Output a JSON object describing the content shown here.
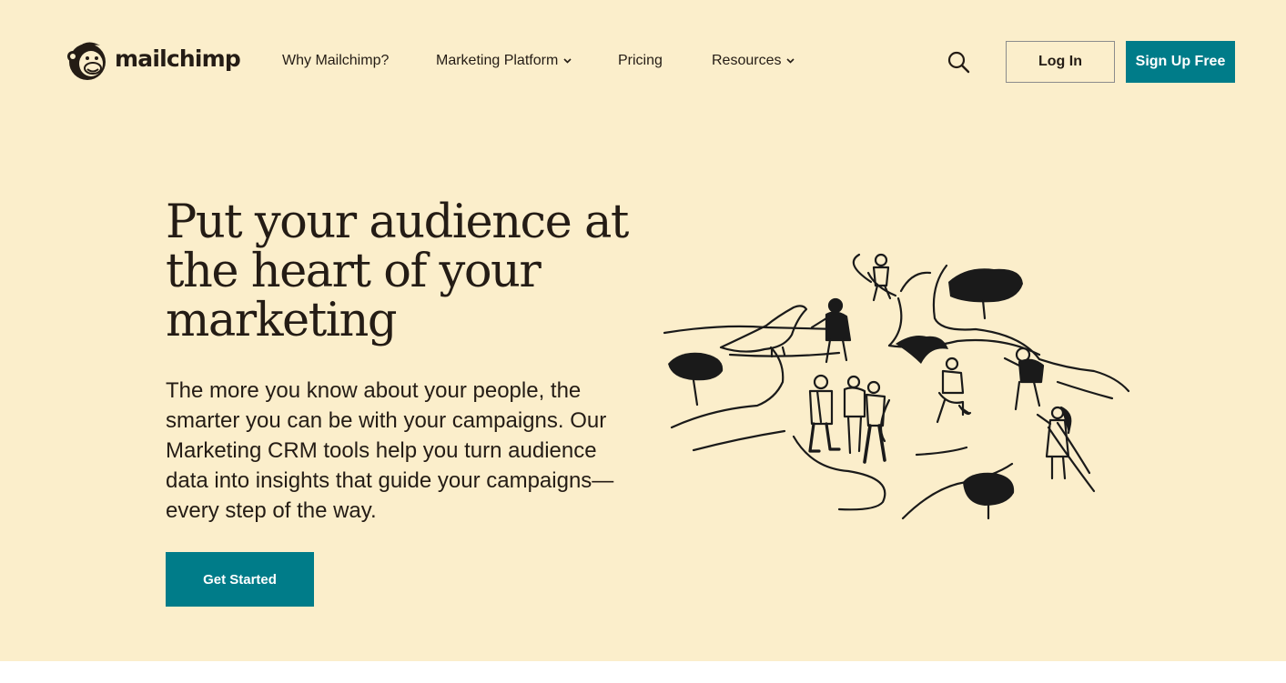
{
  "brand": {
    "name": "mailchimp",
    "accent": "#007c89",
    "background": "#fbeecb"
  },
  "header": {
    "nav": [
      {
        "label": "Why Mailchimp?",
        "dropdown": false
      },
      {
        "label": "Marketing Platform",
        "dropdown": true
      },
      {
        "label": "Pricing",
        "dropdown": false
      },
      {
        "label": "Resources",
        "dropdown": true
      }
    ],
    "search_icon": "search-icon",
    "login_label": "Log In",
    "signup_label": "Sign Up Free"
  },
  "hero": {
    "title_lines": [
      "Put your audience at",
      "the heart of your",
      "marketing"
    ],
    "body_lines": [
      "The more you know about your people, the",
      "smarter you can be with your campaigns. Our",
      "Marketing CRM tools help you turn audience",
      "data into insights that guide your campaigns—",
      "every step of the way."
    ],
    "cta_label": "Get Started"
  }
}
